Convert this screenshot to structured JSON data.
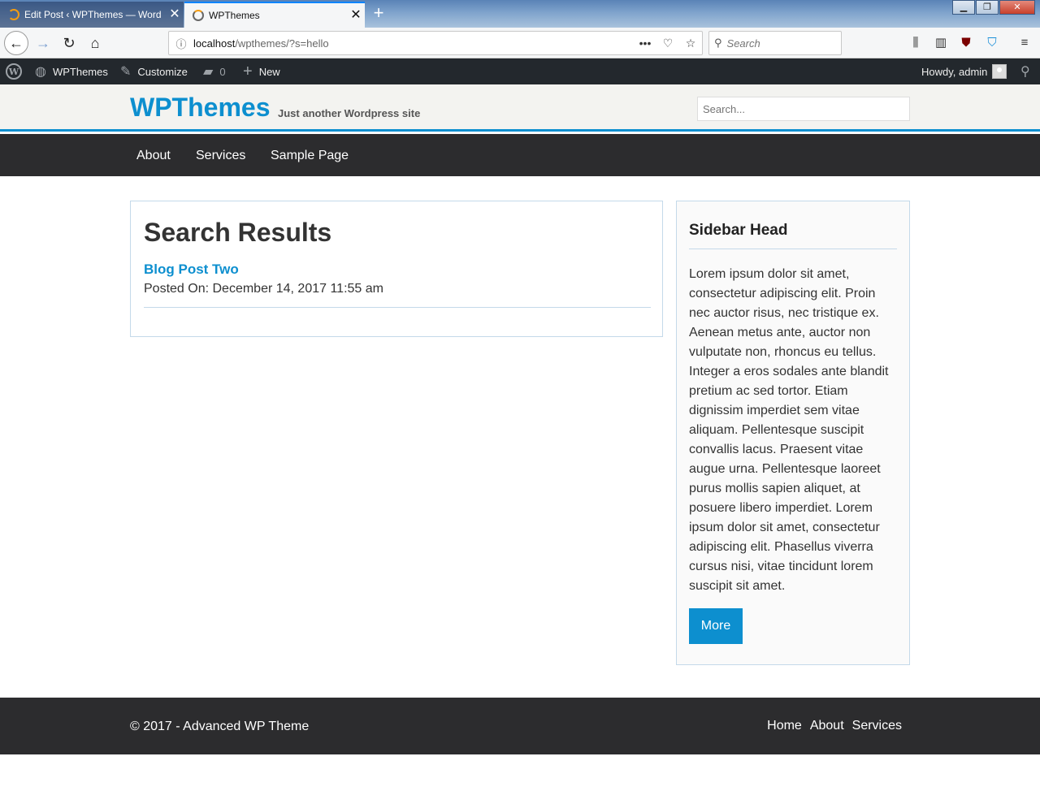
{
  "browser": {
    "tabs": [
      {
        "title": "Edit Post ‹ WPThemes — Word"
      },
      {
        "title": "WPThemes"
      }
    ],
    "new_tab_symbol": "+",
    "url_host": "localhost",
    "url_path": "/wpthemes/?s=hello",
    "search_placeholder": "Search",
    "icons": [
      "back-icon",
      "forward-icon",
      "reload-icon",
      "home-icon",
      "info-icon",
      "page-actions-icon",
      "pocket-icon",
      "bookmark-star-icon",
      "search-icon",
      "library-icon",
      "sidebar-icon",
      "ublock-icon",
      "privacy-badger-icon",
      "menu-icon"
    ]
  },
  "admin_bar": {
    "site_name": "WPThemes",
    "customize": "Customize",
    "comments_count": "0",
    "new": "New",
    "howdy": "Howdy, admin"
  },
  "site": {
    "title": "WPThemes",
    "description": "Just another Wordpress site",
    "search_placeholder": "Search...",
    "accent_color": "#0d8fcf"
  },
  "nav": {
    "items": [
      "About",
      "Services",
      "Sample Page"
    ]
  },
  "main": {
    "heading": "Search Results",
    "post_title": "Blog Post Two",
    "post_meta": "Posted On: December 14, 2017 11:55 am"
  },
  "sidebar": {
    "heading": "Sidebar Head",
    "text": "Lorem ipsum dolor sit amet, consectetur adipiscing elit. Proin nec auctor risus, nec tristique ex. Aenean metus ante, auctor non vulputate non, rhoncus eu tellus. Integer a eros sodales ante blandit pretium ac sed tortor. Etiam dignissim imperdiet sem vitae aliquam. Pellentesque suscipit convallis lacus. Praesent vitae augue urna. Pellentesque laoreet purus mollis sapien aliquet, at posuere libero imperdiet. Lorem ipsum dolor sit amet, consectetur adipiscing elit. Phasellus viverra cursus nisi, vitae tincidunt lorem suscipit sit amet.",
    "button": "More"
  },
  "footer": {
    "copyright": "© 2017 - Advanced WP Theme",
    "links": [
      "Home",
      "About",
      "Services"
    ]
  }
}
